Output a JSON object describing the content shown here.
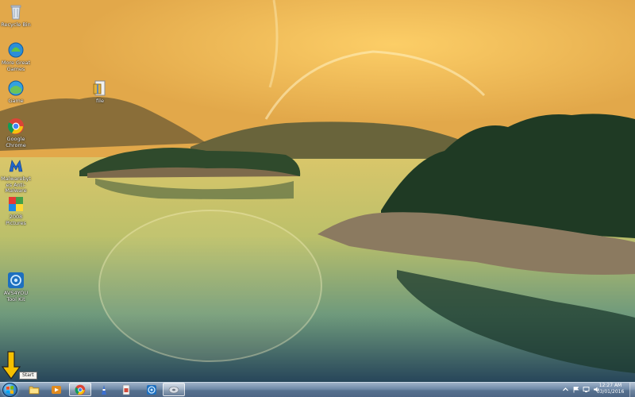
{
  "desktop_icons": [
    {
      "label": "Recycle Bin",
      "icon": "recycle-bin-icon"
    },
    {
      "label": "More Great Games",
      "icon": "games-icon"
    },
    {
      "label": "Game",
      "icon": "game-icon"
    },
    {
      "label": "Google Chrome",
      "icon": "chrome-icon"
    },
    {
      "label": "Malwarebytes Anti-Malware",
      "icon": "malwarebytes-icon"
    },
    {
      "label": "2008 Pictures",
      "icon": "pictures-icon"
    },
    {
      "label": "AVS4YOU Tool Kit",
      "icon": "avs-icon"
    },
    {
      "label": "file",
      "icon": "file-icon"
    }
  ],
  "taskbar": {
    "start_tooltip": "Start",
    "pinned": [
      {
        "name": "windows-explorer",
        "icon": "folder-icon"
      },
      {
        "name": "media-player",
        "icon": "media-player-icon"
      },
      {
        "name": "google-chrome",
        "icon": "chrome-icon"
      },
      {
        "name": "app-4",
        "icon": "app-icon"
      },
      {
        "name": "app-5",
        "icon": "document-app-icon"
      },
      {
        "name": "app-6",
        "icon": "target-icon"
      },
      {
        "name": "app-7",
        "icon": "disk-icon"
      }
    ]
  },
  "tray": {
    "time": "12:27 AM",
    "date": "03/01/2016"
  },
  "colors": {
    "taskbar": "#56718f",
    "annotation_arrow": "#f5c000"
  }
}
